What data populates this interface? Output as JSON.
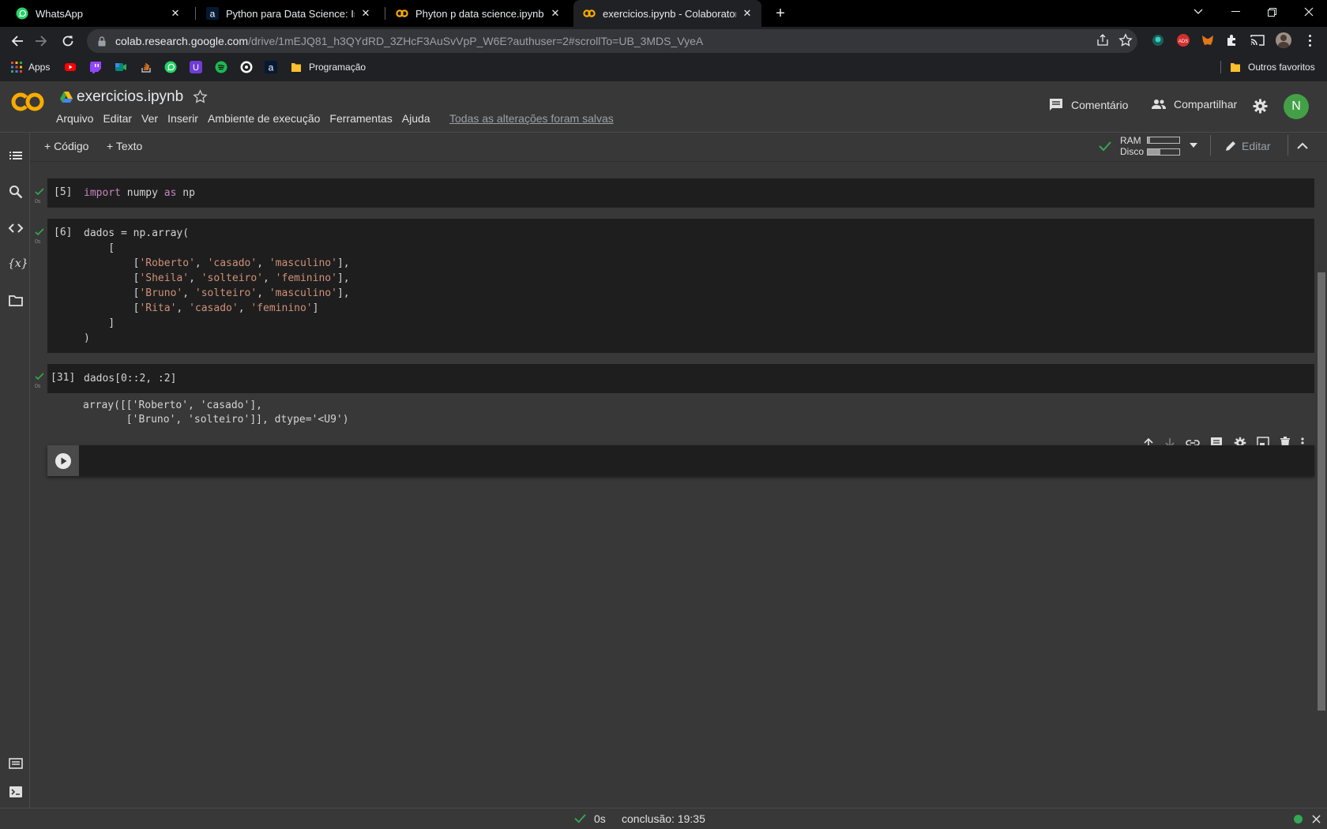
{
  "browser": {
    "tabs": [
      {
        "title": "WhatsApp",
        "icon": "whatsapp-icon",
        "active": false
      },
      {
        "title": "Python para Data Science: Introd",
        "icon": "alura-icon",
        "active": false
      },
      {
        "title": "Phyton p data science.ipynb - Co",
        "icon": "colab-icon",
        "active": false
      },
      {
        "title": "exercicios.ipynb - Colaboratory",
        "icon": "colab-icon",
        "active": true
      }
    ],
    "url_host": "colab.research.google.com",
    "url_path": "/drive/1mEJQ81_h3QYdRD_3ZHcF3AuSvVpP_W6E?authuser=2#scrollTo=UB_3MDS_VyeA",
    "bookmarks": {
      "apps": "Apps",
      "folder": "Programação",
      "other": "Outros favoritos"
    }
  },
  "colab": {
    "notebook_title": "exercicios.ipynb",
    "menus": [
      "Arquivo",
      "Editar",
      "Ver",
      "Inserir",
      "Ambiente de execução",
      "Ferramentas",
      "Ajuda"
    ],
    "saved_status": "Todas as alterações foram salvas",
    "comment": "Comentário",
    "share": "Compartilhar",
    "avatar_letter": "N",
    "add_code": "+ Código",
    "add_text": "+ Texto",
    "ram_label": "RAM",
    "disk_label": "Disco",
    "edit_label": "Editar",
    "ram_usage": 0.08,
    "disk_usage": 0.4
  },
  "cells": [
    {
      "exec": "[5]",
      "time": "0s"
    },
    {
      "exec": "[6]",
      "time": "0s"
    },
    {
      "exec": "[31]",
      "time": "0s"
    }
  ],
  "code": {
    "c1": {
      "kw1": "import",
      "a": " numpy ",
      "kw2": "as",
      "b": " np"
    },
    "c2": {
      "l1": "dados = np.array(",
      "l2": "    [",
      "rows": [
        [
          "'Roberto'",
          "'casado'",
          "'masculino'"
        ],
        [
          "'Sheila'",
          "'solteiro'",
          "'feminino'"
        ],
        [
          "'Bruno'",
          "'solteiro'",
          "'masculino'"
        ],
        [
          "'Rita'",
          "'casado'",
          "'feminino'"
        ]
      ],
      "l7": "    ]",
      "l8": ")"
    },
    "c3": {
      "text": "dados[0::2, :2]"
    },
    "output_l1": "array([['Roberto', 'casado'],",
    "output_l2": "       ['Bruno', 'solteiro']], dtype='<U9')"
  },
  "statusbar": {
    "time": "0s",
    "conclusion": "conclusão: 19:35"
  },
  "colors": {
    "accent_orange": "#f9ab00",
    "green": "#34a853",
    "string": "#ce9178",
    "keyword": "#c586c0"
  }
}
